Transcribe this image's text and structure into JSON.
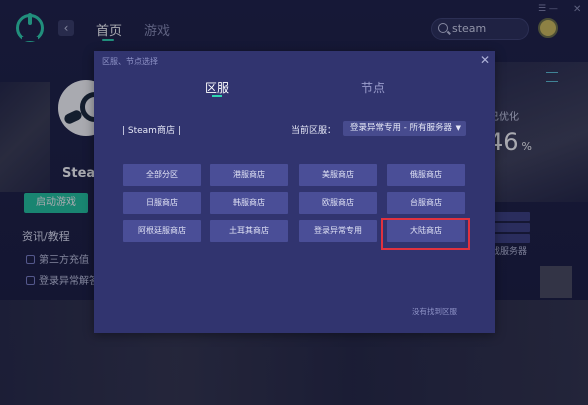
{
  "header": {
    "nav_home": "首页",
    "nav_games": "游戏",
    "back_glyph": "‹",
    "search_value": "steam",
    "window_min": "☰  —",
    "window_close": "✕"
  },
  "left_panel": {
    "game_name": "Steam",
    "start_button": "启动游戏",
    "section_heading": "资讯/教程",
    "links": [
      "第三方充值",
      "登录异常解答"
    ]
  },
  "right_panel": {
    "optimize_label": "已优化",
    "percent_value": "46",
    "percent_unit": "%",
    "caption": "游戏服务器"
  },
  "modal": {
    "title": "区服、节点选择",
    "close_glyph": "✕",
    "tabs": [
      "区服",
      "节点"
    ],
    "active_tab": "区服",
    "store_label": "| Steam商店 |",
    "current_label": "当前区服：",
    "current_value": "登录异常专用 - 所有服务器",
    "caret": "▼",
    "regions": [
      "全部分区",
      "港服商店",
      "美服商店",
      "俄服商店",
      "日服商店",
      "韩服商店",
      "欧服商店",
      "台服商店",
      "阿根廷服商店",
      "土耳其商店",
      "登录异常专用",
      "大陆商店"
    ],
    "highlighted_region": "大陆商店",
    "not_found_link": "没有找到区服",
    "accent_color": "#2fd6b0",
    "highlight_color": "#e0323f"
  }
}
